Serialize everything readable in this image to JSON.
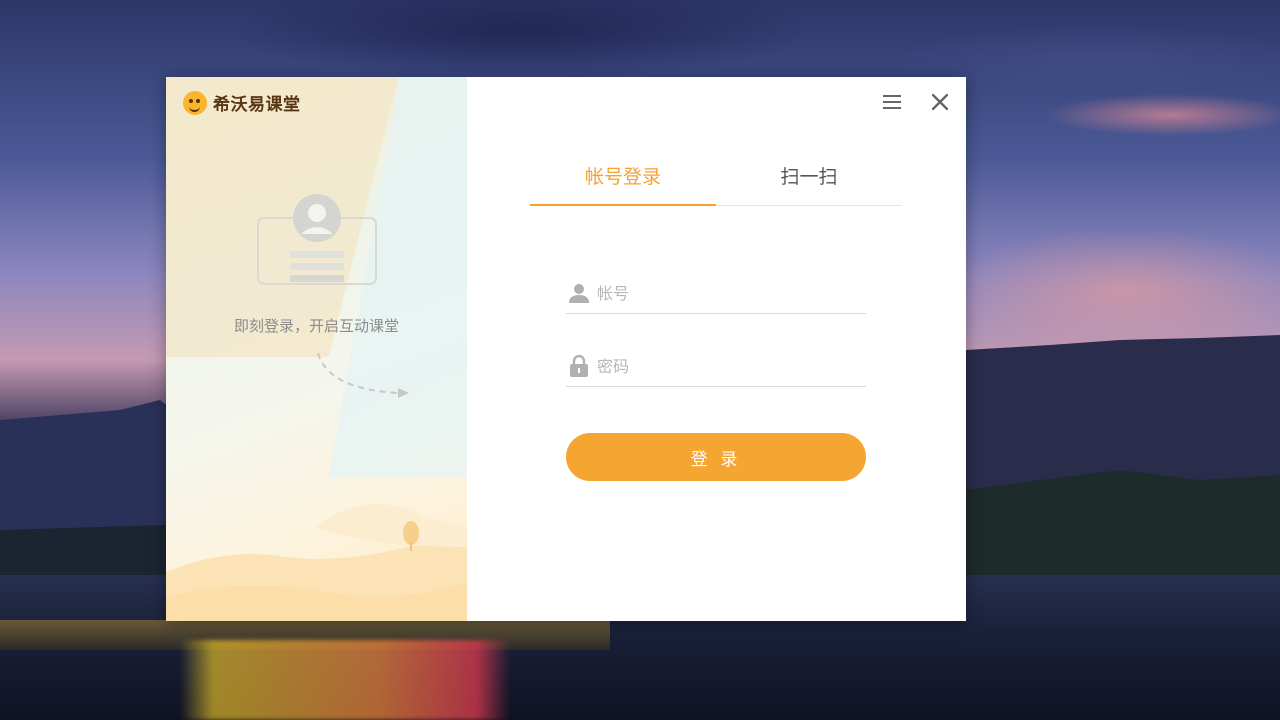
{
  "app": {
    "name": "希沃易课堂",
    "slogan": "即刻登录，开启互动课堂"
  },
  "window_controls": {
    "menu_icon": "menu-icon",
    "close_icon": "close-icon"
  },
  "tabs": [
    {
      "label": "帐号登录",
      "active": true
    },
    {
      "label": "扫一扫",
      "active": false
    }
  ],
  "form": {
    "account": {
      "placeholder": "帐号",
      "value": "",
      "icon": "user-icon"
    },
    "password": {
      "placeholder": "密码",
      "value": "",
      "icon": "lock-icon"
    },
    "login_label": "登 录"
  },
  "colors": {
    "accent": "#f5a22f",
    "button": "#f5a531",
    "brand_text": "#5a3514"
  }
}
